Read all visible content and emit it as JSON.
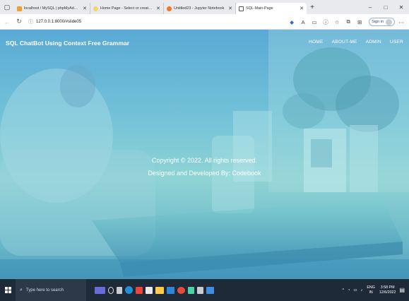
{
  "browser": {
    "tabs": [
      {
        "title": "localhost / MySQL | phpMyAdmin",
        "favicon_color": "#f0a030",
        "active": false
      },
      {
        "title": "Home Page - Select or create a...",
        "favicon_color": "#f5d36a",
        "active": false
      },
      {
        "title": "Untitled23 - Jupyter Notebook",
        "favicon_color": "#f37626",
        "active": false
      },
      {
        "title": "SQL-Main-Page",
        "favicon_color": "#ffffff",
        "active": true
      }
    ],
    "address": "127.0.0.1:8000/#slide05",
    "sign_in_label": "Sign in",
    "window_controls": [
      "–",
      "□",
      "✕"
    ]
  },
  "site": {
    "brand": "SQL ChatBot Using Context Free Grammar",
    "menu": [
      "HOME",
      "ABOUT-ME",
      "ADMIN",
      "USER"
    ],
    "copyright": "Copyright © 2022. All rights reserved.",
    "credit": "Designed and Developed By: Codebook"
  },
  "taskbar": {
    "search_placeholder": "Type here to search",
    "tray": {
      "lang": "ENG",
      "region": "IN",
      "time": "3:58 PM",
      "date": "12/6/2022"
    }
  },
  "colors": {
    "overlay": "#5aa9d6",
    "taskbar": "#1f2a38"
  }
}
